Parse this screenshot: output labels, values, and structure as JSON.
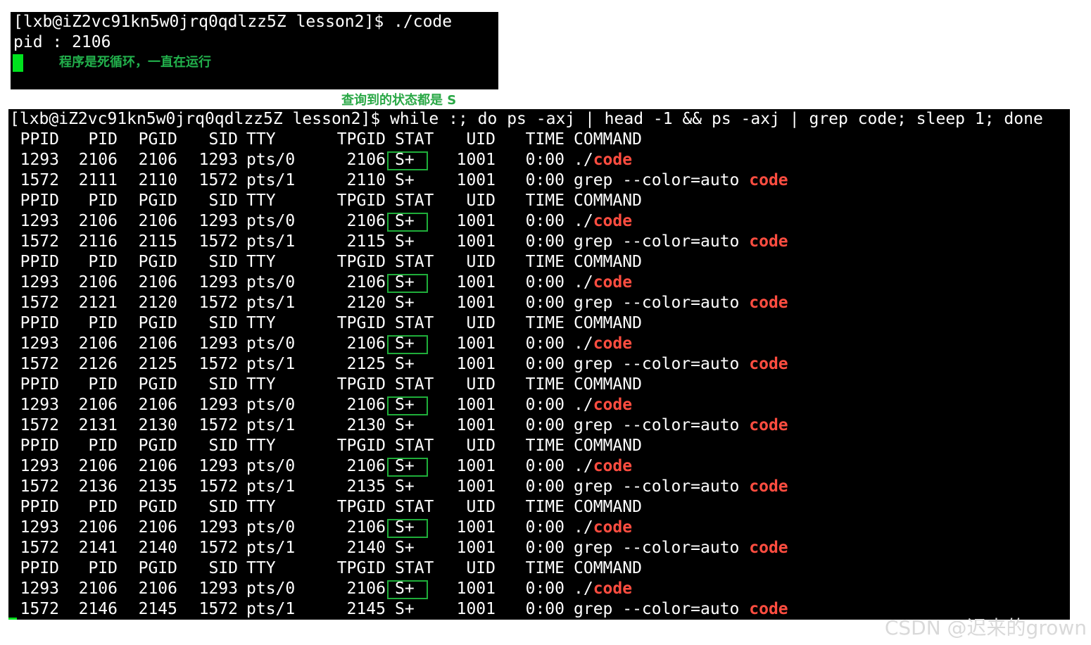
{
  "top_terminal": {
    "lines": [
      "[lxb@iZ2vc91kn5w0jrq0qdlzz5Z lesson2]$ ./code",
      "pid : 2106"
    ],
    "annotation": "程序是死循环，一直在运行"
  },
  "middle_annotation": "查询到的状态都是 S",
  "bottom_terminal": {
    "command_line": "[lxb@iZ2vc91kn5w0jrq0qdlzz5Z lesson2]$ while :; do ps -axj | head -1 && ps -axj | grep code; sleep 1; done",
    "rows": [
      {
        "type": "header",
        "ppid": "PPID",
        "pid": "PID",
        "pgid": "PGID",
        "sid": "SID",
        "tty": "TTY",
        "tpgid": "TPGID",
        "stat": "STAT",
        "uid": "UID",
        "time": "TIME",
        "cmd": "COMMAND",
        "hl": ""
      },
      {
        "type": "proc",
        "ppid": "1293",
        "pid": "2106",
        "pgid": "2106",
        "sid": "1293",
        "tty": "pts/0",
        "tpgid": "2106",
        "stat": "S+",
        "uid": "1001",
        "time": "0:00",
        "cmd": "./",
        "hl": "code"
      },
      {
        "type": "grep",
        "ppid": "1572",
        "pid": "2111",
        "pgid": "2110",
        "sid": "1572",
        "tty": "pts/1",
        "tpgid": "2110",
        "stat": "S+",
        "uid": "1001",
        "time": "0:00",
        "cmd": "grep --color=auto ",
        "hl": "code"
      },
      {
        "type": "header",
        "ppid": "PPID",
        "pid": "PID",
        "pgid": "PGID",
        "sid": "SID",
        "tty": "TTY",
        "tpgid": "TPGID",
        "stat": "STAT",
        "uid": "UID",
        "time": "TIME",
        "cmd": "COMMAND",
        "hl": ""
      },
      {
        "type": "proc",
        "ppid": "1293",
        "pid": "2106",
        "pgid": "2106",
        "sid": "1293",
        "tty": "pts/0",
        "tpgid": "2106",
        "stat": "S+",
        "uid": "1001",
        "time": "0:00",
        "cmd": "./",
        "hl": "code"
      },
      {
        "type": "grep",
        "ppid": "1572",
        "pid": "2116",
        "pgid": "2115",
        "sid": "1572",
        "tty": "pts/1",
        "tpgid": "2115",
        "stat": "S+",
        "uid": "1001",
        "time": "0:00",
        "cmd": "grep --color=auto ",
        "hl": "code"
      },
      {
        "type": "header",
        "ppid": "PPID",
        "pid": "PID",
        "pgid": "PGID",
        "sid": "SID",
        "tty": "TTY",
        "tpgid": "TPGID",
        "stat": "STAT",
        "uid": "UID",
        "time": "TIME",
        "cmd": "COMMAND",
        "hl": ""
      },
      {
        "type": "proc",
        "ppid": "1293",
        "pid": "2106",
        "pgid": "2106",
        "sid": "1293",
        "tty": "pts/0",
        "tpgid": "2106",
        "stat": "S+",
        "uid": "1001",
        "time": "0:00",
        "cmd": "./",
        "hl": "code"
      },
      {
        "type": "grep",
        "ppid": "1572",
        "pid": "2121",
        "pgid": "2120",
        "sid": "1572",
        "tty": "pts/1",
        "tpgid": "2120",
        "stat": "S+",
        "uid": "1001",
        "time": "0:00",
        "cmd": "grep --color=auto ",
        "hl": "code"
      },
      {
        "type": "header",
        "ppid": "PPID",
        "pid": "PID",
        "pgid": "PGID",
        "sid": "SID",
        "tty": "TTY",
        "tpgid": "TPGID",
        "stat": "STAT",
        "uid": "UID",
        "time": "TIME",
        "cmd": "COMMAND",
        "hl": ""
      },
      {
        "type": "proc",
        "ppid": "1293",
        "pid": "2106",
        "pgid": "2106",
        "sid": "1293",
        "tty": "pts/0",
        "tpgid": "2106",
        "stat": "S+",
        "uid": "1001",
        "time": "0:00",
        "cmd": "./",
        "hl": "code"
      },
      {
        "type": "grep",
        "ppid": "1572",
        "pid": "2126",
        "pgid": "2125",
        "sid": "1572",
        "tty": "pts/1",
        "tpgid": "2125",
        "stat": "S+",
        "uid": "1001",
        "time": "0:00",
        "cmd": "grep --color=auto ",
        "hl": "code"
      },
      {
        "type": "header",
        "ppid": "PPID",
        "pid": "PID",
        "pgid": "PGID",
        "sid": "SID",
        "tty": "TTY",
        "tpgid": "TPGID",
        "stat": "STAT",
        "uid": "UID",
        "time": "TIME",
        "cmd": "COMMAND",
        "hl": ""
      },
      {
        "type": "proc",
        "ppid": "1293",
        "pid": "2106",
        "pgid": "2106",
        "sid": "1293",
        "tty": "pts/0",
        "tpgid": "2106",
        "stat": "S+",
        "uid": "1001",
        "time": "0:00",
        "cmd": "./",
        "hl": "code"
      },
      {
        "type": "grep",
        "ppid": "1572",
        "pid": "2131",
        "pgid": "2130",
        "sid": "1572",
        "tty": "pts/1",
        "tpgid": "2130",
        "stat": "S+",
        "uid": "1001",
        "time": "0:00",
        "cmd": "grep --color=auto ",
        "hl": "code"
      },
      {
        "type": "header",
        "ppid": "PPID",
        "pid": "PID",
        "pgid": "PGID",
        "sid": "SID",
        "tty": "TTY",
        "tpgid": "TPGID",
        "stat": "STAT",
        "uid": "UID",
        "time": "TIME",
        "cmd": "COMMAND",
        "hl": ""
      },
      {
        "type": "proc",
        "ppid": "1293",
        "pid": "2106",
        "pgid": "2106",
        "sid": "1293",
        "tty": "pts/0",
        "tpgid": "2106",
        "stat": "S+",
        "uid": "1001",
        "time": "0:00",
        "cmd": "./",
        "hl": "code"
      },
      {
        "type": "grep",
        "ppid": "1572",
        "pid": "2136",
        "pgid": "2135",
        "sid": "1572",
        "tty": "pts/1",
        "tpgid": "2135",
        "stat": "S+",
        "uid": "1001",
        "time": "0:00",
        "cmd": "grep --color=auto ",
        "hl": "code"
      },
      {
        "type": "header",
        "ppid": "PPID",
        "pid": "PID",
        "pgid": "PGID",
        "sid": "SID",
        "tty": "TTY",
        "tpgid": "TPGID",
        "stat": "STAT",
        "uid": "UID",
        "time": "TIME",
        "cmd": "COMMAND",
        "hl": ""
      },
      {
        "type": "proc",
        "ppid": "1293",
        "pid": "2106",
        "pgid": "2106",
        "sid": "1293",
        "tty": "pts/0",
        "tpgid": "2106",
        "stat": "S+",
        "uid": "1001",
        "time": "0:00",
        "cmd": "./",
        "hl": "code"
      },
      {
        "type": "grep",
        "ppid": "1572",
        "pid": "2141",
        "pgid": "2140",
        "sid": "1572",
        "tty": "pts/1",
        "tpgid": "2140",
        "stat": "S+",
        "uid": "1001",
        "time": "0:00",
        "cmd": "grep --color=auto ",
        "hl": "code"
      },
      {
        "type": "header",
        "ppid": "PPID",
        "pid": "PID",
        "pgid": "PGID",
        "sid": "SID",
        "tty": "TTY",
        "tpgid": "TPGID",
        "stat": "STAT",
        "uid": "UID",
        "time": "TIME",
        "cmd": "COMMAND",
        "hl": ""
      },
      {
        "type": "proc",
        "ppid": "1293",
        "pid": "2106",
        "pgid": "2106",
        "sid": "1293",
        "tty": "pts/0",
        "tpgid": "2106",
        "stat": "S+",
        "uid": "1001",
        "time": "0:00",
        "cmd": "./",
        "hl": "code"
      },
      {
        "type": "grep",
        "ppid": "1572",
        "pid": "2146",
        "pgid": "2145",
        "sid": "1572",
        "tty": "pts/1",
        "tpgid": "2145",
        "stat": "S+",
        "uid": "1001",
        "time": "0:00",
        "cmd": "grep --color=auto ",
        "hl": "code"
      }
    ]
  },
  "watermark": "CSDN @迟来的grown",
  "colors": {
    "terminal_bg": "#000000",
    "terminal_fg": "#ffffff",
    "highlight": "#ff4d40",
    "annotation_green": "#22b14c",
    "cursor_green": "#00e21e"
  }
}
